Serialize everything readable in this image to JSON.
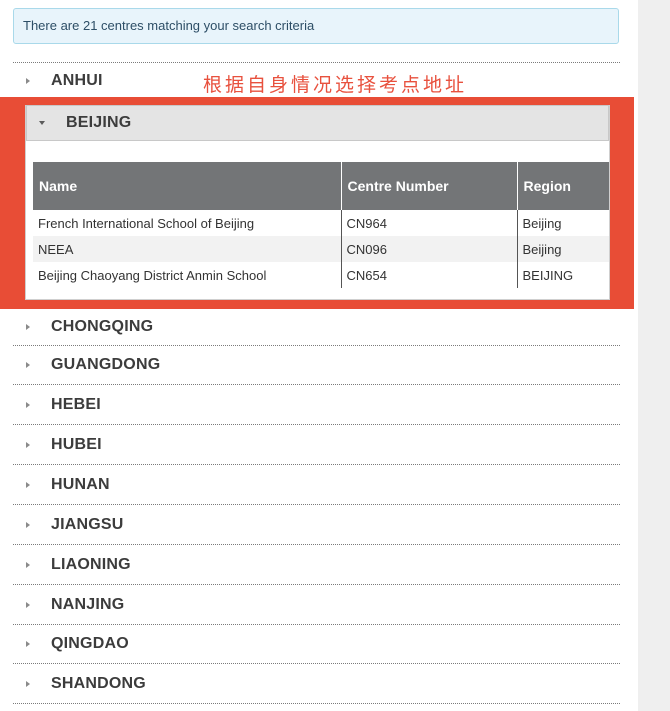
{
  "notice": {
    "text": "There are 21 centres matching your search criteria"
  },
  "annotation": {
    "text": "根据自身情况选择考点地址"
  },
  "colors": {
    "highlight": "#e84d36",
    "table_header": "#737577",
    "notice_bg": "#e8f4fb"
  },
  "regions": {
    "anhui": "ANHUI",
    "beijing": "BEIJING",
    "chongqing": "CHONGQING",
    "guangdong": "GUANGDONG",
    "hebei": "HEBEI",
    "hubei": "HUBEI",
    "hunan": "HUNAN",
    "jiangsu": "JIANGSU",
    "liaoning": "LIAONING",
    "nanjing": "NANJING",
    "qingdao": "QINGDAO",
    "shandong": "SHANDONG"
  },
  "table": {
    "headers": [
      "Name",
      "Centre Number",
      "Region"
    ],
    "rows": [
      [
        "French International School of Beijing",
        "CN964",
        "Beijing"
      ],
      [
        "NEEA",
        "CN096",
        "Beijing"
      ],
      [
        "Beijing Chaoyang District Anmin School",
        "CN654",
        "BEIJING"
      ]
    ]
  }
}
